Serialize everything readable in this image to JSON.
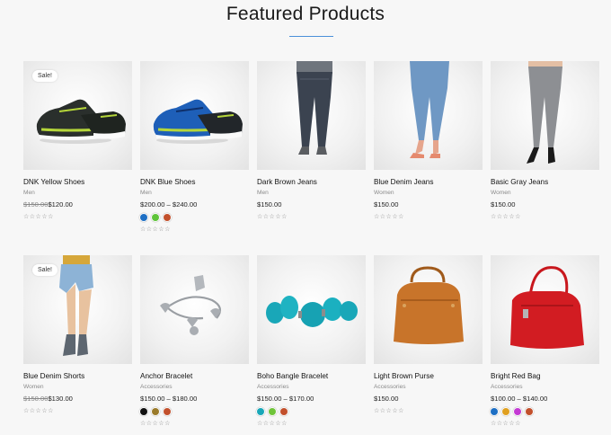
{
  "section": {
    "title": "Featured Products"
  },
  "rows": [
    [
      {
        "name": "DNK Yellow Shoes",
        "category": "Men",
        "price_old": "$150.00",
        "price": "$120.00",
        "sale": "Sale!",
        "rating": "☆☆☆☆☆",
        "image": "sneaker-yellow-icon",
        "swatches": []
      },
      {
        "name": "DNK Blue Shoes",
        "category": "Men",
        "price": "$200.00 – $240.00",
        "rating": "☆☆☆☆☆",
        "image": "sneaker-blue-icon",
        "swatches": [
          "#1e6fc4",
          "#5fc43a",
          "#c2502c"
        ]
      },
      {
        "name": "Dark Brown Jeans",
        "category": "Men",
        "price": "$150.00",
        "rating": "☆☆☆☆☆",
        "image": "dark-jeans-icon",
        "swatches": []
      },
      {
        "name": "Blue Denim Jeans",
        "category": "Women",
        "price": "$150.00",
        "rating": "☆☆☆☆☆",
        "image": "blue-jeans-icon",
        "swatches": []
      },
      {
        "name": "Basic Gray Jeans",
        "category": "Women",
        "price": "$150.00",
        "rating": "☆☆☆☆☆",
        "image": "gray-jeans-icon",
        "swatches": []
      }
    ],
    [
      {
        "name": "Blue Denim Shorts",
        "category": "Women",
        "price_old": "$150.00",
        "price": "$130.00",
        "sale": "Sale!",
        "rating": "☆☆☆☆☆",
        "image": "denim-shorts-icon",
        "swatches": []
      },
      {
        "name": "Anchor Bracelet",
        "category": "Accessories",
        "price": "$150.00 – $180.00",
        "rating": "☆☆☆☆☆",
        "image": "silver-bracelet-icon",
        "swatches": [
          "#111111",
          "#9a7a2a",
          "#c2502c"
        ]
      },
      {
        "name": "Boho Bangle Bracelet",
        "category": "Accessories",
        "price": "$150.00 – $170.00",
        "rating": "☆☆☆☆☆",
        "image": "turquoise-bracelet-icon",
        "swatches": [
          "#19a7b8",
          "#6fc43a",
          "#c2502c"
        ]
      },
      {
        "name": "Light Brown Purse",
        "category": "Accessories",
        "price": "$150.00",
        "rating": "☆☆☆☆☆",
        "image": "brown-purse-icon",
        "swatches": []
      },
      {
        "name": "Bright Red Bag",
        "category": "Accessories",
        "price": "$100.00 – $140.00",
        "rating": "☆☆☆☆☆",
        "image": "red-bag-icon",
        "swatches": [
          "#1e6fc4",
          "#e0a020",
          "#c43ad4",
          "#c2502c"
        ]
      }
    ]
  ]
}
